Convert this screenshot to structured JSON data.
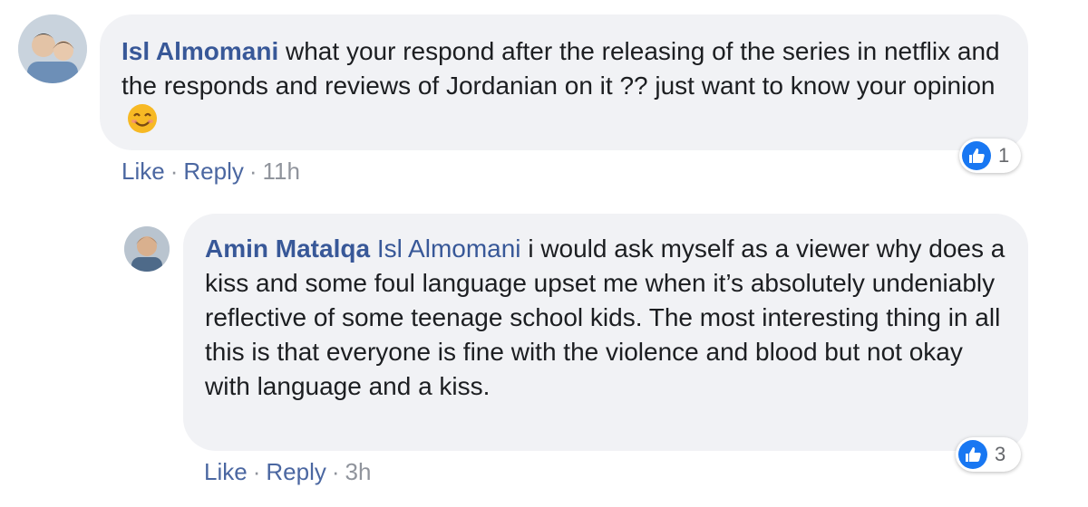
{
  "comments": [
    {
      "author": "Isl Almomani",
      "text": "what your respond after the releasing of the series in netflix and the responds and reviews of Jordanian on it ?? just want to know your opinion",
      "emoji": "smiling-face-emoji",
      "reaction_icon": "like-icon",
      "reaction_count": "1",
      "actions": {
        "like": "Like",
        "sep": "·",
        "reply": "Reply",
        "time": "11h"
      }
    },
    {
      "author": "Amin Matalqa",
      "mention": "Isl Almomani",
      "text": "i would ask myself as a viewer why does a kiss and some foul language upset me when it’s absolutely undeniably reflective of some teenage school kids. The most interesting thing in all this is that everyone is fine with the violence and blood but not okay with language and a kiss.",
      "reaction_icon": "like-icon",
      "reaction_count": "3",
      "actions": {
        "like": "Like",
        "sep": "·",
        "reply": "Reply",
        "time": "3h"
      }
    }
  ],
  "colors": {
    "bubble": "#f1f2f5",
    "author": "#385898",
    "link": "#4b67a1",
    "like_blue": "#1877f2"
  }
}
